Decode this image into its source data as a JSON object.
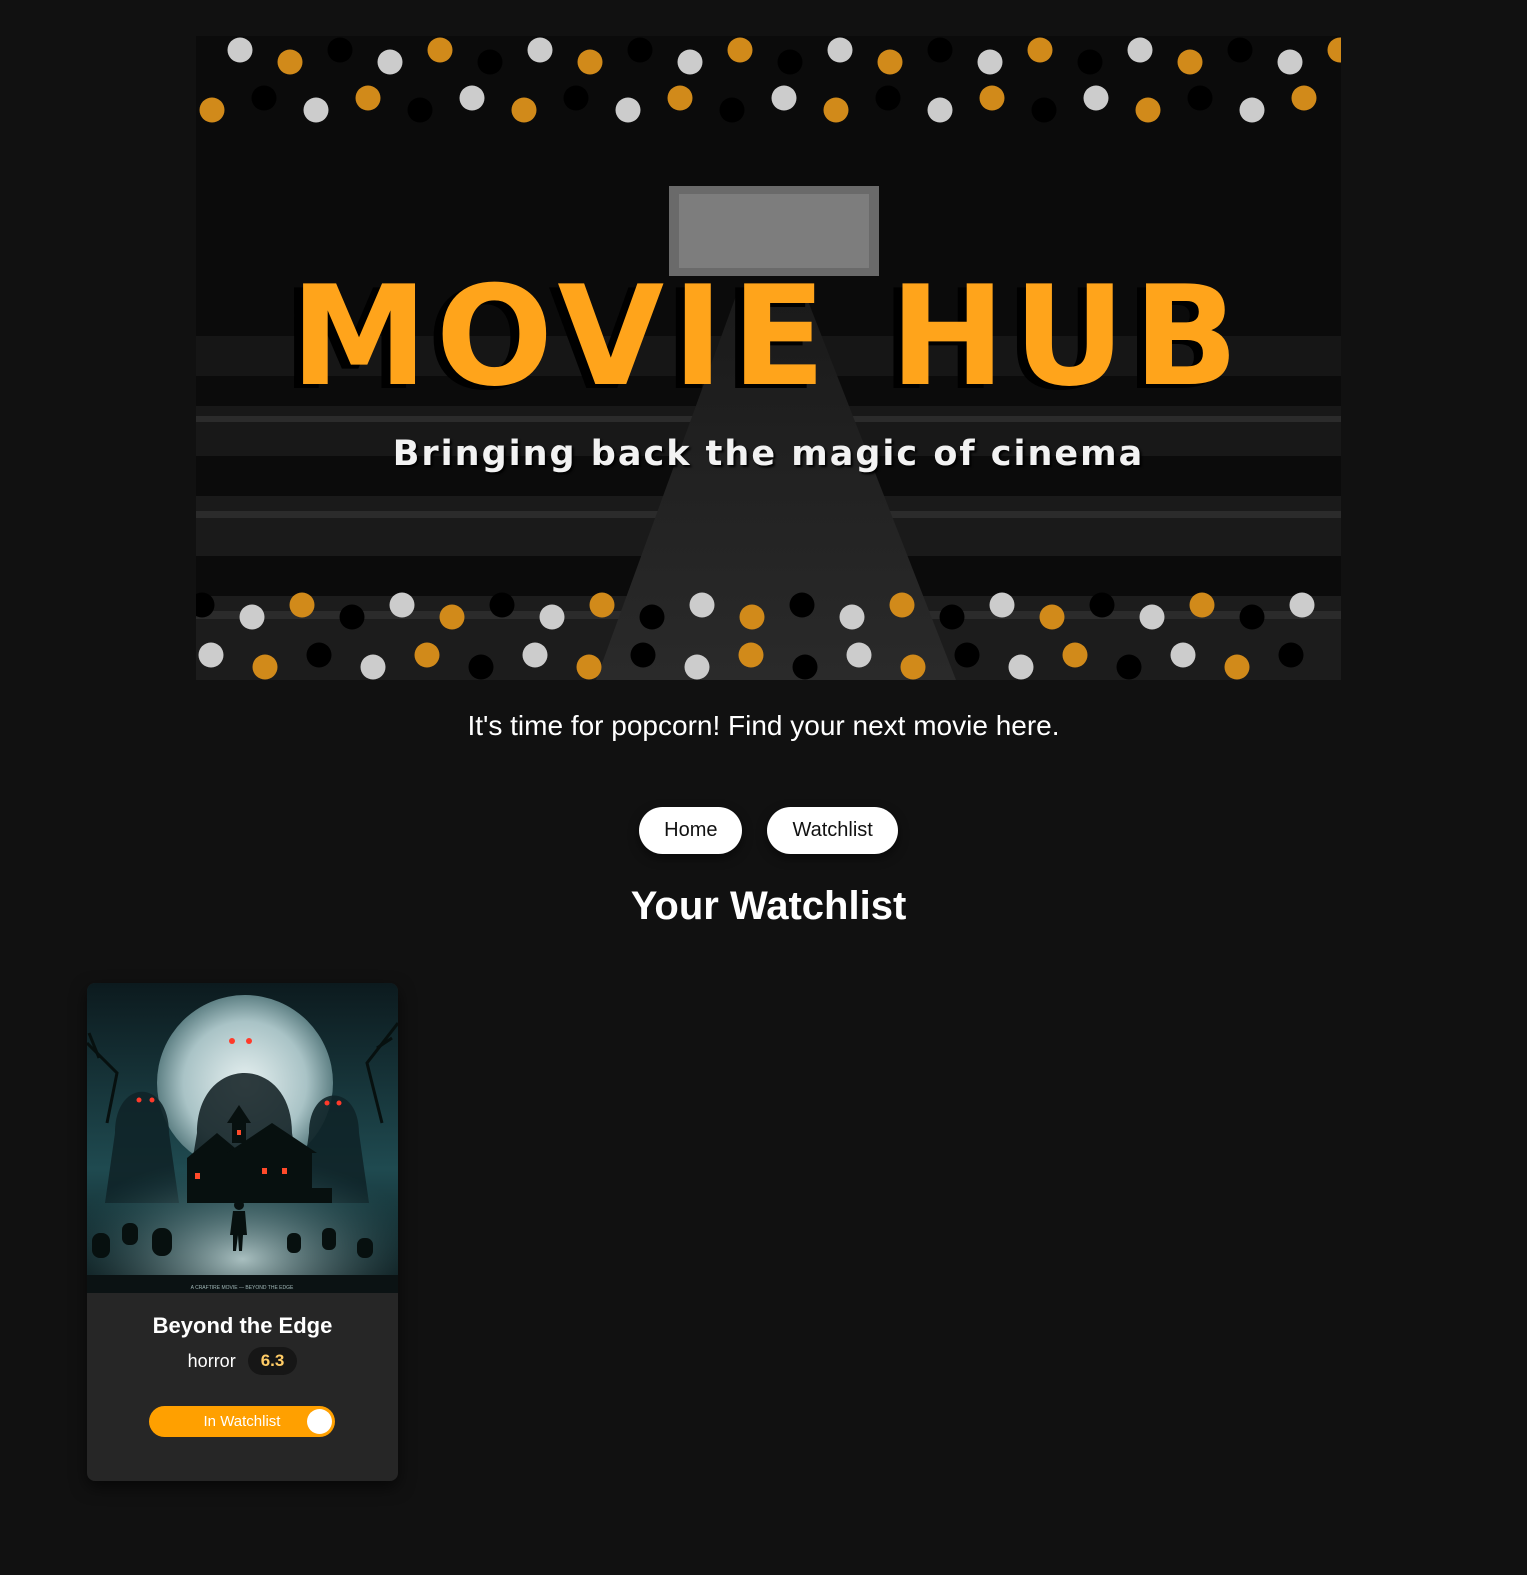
{
  "hero": {
    "title": "MOVIE HUB",
    "subtitle": "Bringing back the magic of cinema"
  },
  "tagline": "It's time for popcorn! Find your next movie here.",
  "nav": {
    "home_label": "Home",
    "watchlist_label": "Watchlist"
  },
  "section": {
    "title": "Your Watchlist"
  },
  "watchlist": [
    {
      "title": "Beyond the Edge",
      "genre": "horror",
      "rating": "6.3",
      "poster_caption": "A CRAFTIRE MOVIE — BEYOND THE EDGE",
      "toggle_label": "In Watchlist",
      "in_watchlist": true
    }
  ],
  "colors": {
    "background": "#111111",
    "accent": "#ffa41b",
    "card": "#262626",
    "toggle": "#ffa000"
  }
}
